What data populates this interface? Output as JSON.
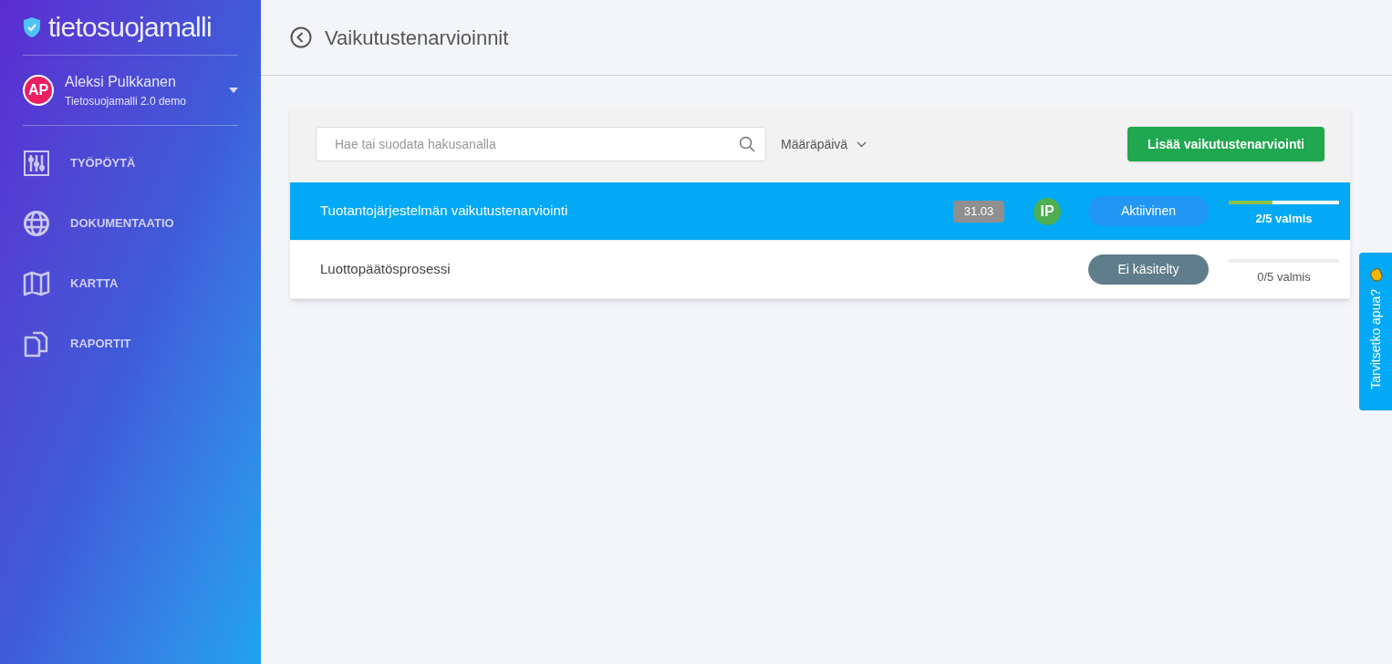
{
  "sidebar": {
    "logo": "tietosuojamalli",
    "user": {
      "initials": "AP",
      "name": "Aleksi Pulkkanen",
      "organization": "Tietosuojamalli 2.0 demo"
    },
    "items": [
      {
        "label": "TYÖPÖYTÄ",
        "kind": "sliders"
      },
      {
        "label": "DOKUMENTAATIO",
        "kind": "globe"
      },
      {
        "label": "KARTTA",
        "kind": "map"
      },
      {
        "label": "RAPORTIT",
        "kind": "documents"
      }
    ]
  },
  "header": {
    "title": "Vaikutustenarvioinnit"
  },
  "toolbar": {
    "search": {
      "placeholder": "Hae tai suodata hakusanalla"
    },
    "sort": "Määräpäivä",
    "add_button": "Lisää vaikutustenarviointi"
  },
  "rows": [
    {
      "name": "Tuotantojärjestelmän vaikutustenarviointi",
      "selected": true,
      "date": "31.03",
      "assignee": "IP",
      "status": {
        "label": "Aktiivinen",
        "kind": "active"
      },
      "progress": {
        "level": 0.4,
        "label": "2/5 valmis"
      }
    },
    {
      "name": "Luottopäätösprosessi",
      "selected": false,
      "status": {
        "label": "Ei käsitelty",
        "kind": "untreated"
      },
      "progress": {
        "level": 0,
        "label": "0/5 valmis"
      }
    }
  ],
  "help_tab": {
    "label": "Tarvitsetko apua?"
  }
}
